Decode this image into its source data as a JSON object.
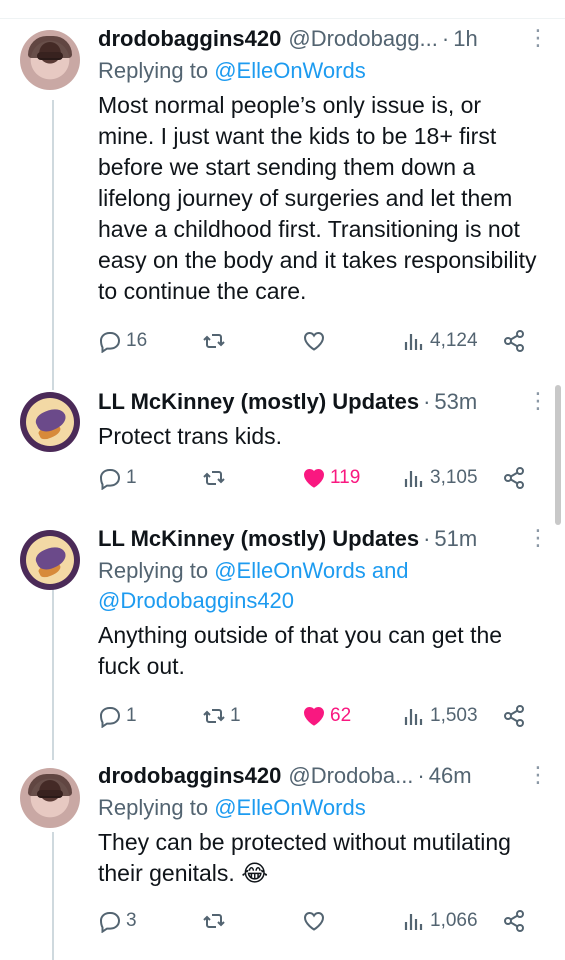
{
  "tweets": [
    {
      "name": "drodobaggins420",
      "handle": "@Drodobagg...",
      "time": "1h",
      "replying_prefix": "Replying to ",
      "replying_to": "@ElleOnWords",
      "replying_and": "",
      "replying_to2": "",
      "text": "Most normal people’s only issue is, or mine. I just want the kids to be 18+ first before we start sending them down a lifelong journey of surgeries and let them have a childhood first. Transitioning is not easy on the body and it takes responsibility to continue the care.",
      "replies": "16",
      "retweets": "",
      "likes": "",
      "views": "4,124"
    },
    {
      "name": "LL McKinney (mostly) Updates",
      "handle": "",
      "time": "53m",
      "text": "Protect trans kids.",
      "replies": "1",
      "retweets": "",
      "likes": "119",
      "views": "3,105"
    },
    {
      "name": "LL McKinney (mostly) Updates",
      "handle": "",
      "time": "51m",
      "replying_prefix": "Replying to ",
      "replying_to": "@ElleOnWords",
      "replying_and": " and ",
      "replying_to2": "@Drodobaggins420",
      "text": "Anything outside of that you can get the fuck out.",
      "replies": "1",
      "retweets": "1",
      "likes": "62",
      "views": "1,503"
    },
    {
      "name": "drodobaggins420",
      "handle": "@Drodoba...",
      "time": "46m",
      "replying_prefix": "Replying to ",
      "replying_to": "@ElleOnWords",
      "replying_and": "",
      "replying_to2": "",
      "text": "They can be protected without mutilating their genitals. 😂",
      "replies": "3",
      "retweets": "",
      "likes": "",
      "views": "1,066"
    }
  ],
  "ui": {
    "dot": "·",
    "more": "⋮"
  },
  "colors": {
    "like_active": "#f91880",
    "link": "#1d9bf0",
    "muted": "#536471"
  }
}
